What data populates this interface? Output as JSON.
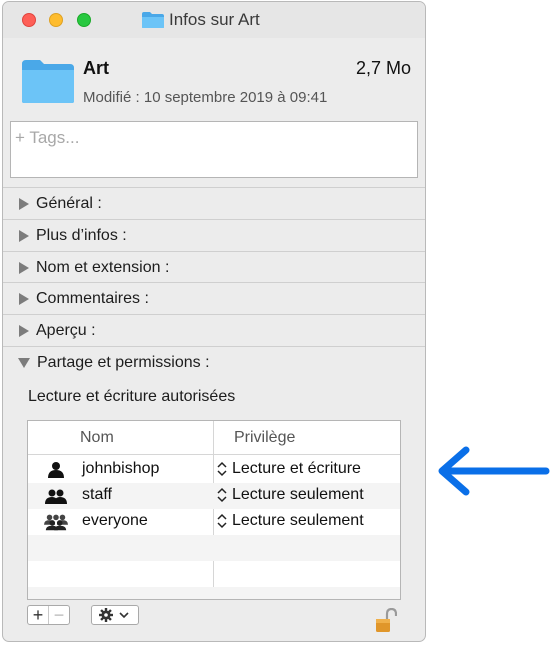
{
  "window": {
    "title": "Infos sur Art",
    "title_icon": "folder-icon"
  },
  "file": {
    "name": "Art",
    "size": "2,7 Mo",
    "modified": "Modifié : 10 septembre 2019 à 09:41",
    "icon": "folder-icon"
  },
  "tags": {
    "placeholder": "+ Tags...",
    "value": ""
  },
  "sections": [
    {
      "label": "Général :",
      "expanded": false
    },
    {
      "label": "Plus d’infos :",
      "expanded": false
    },
    {
      "label": "Nom et extension :",
      "expanded": false
    },
    {
      "label": "Commentaires :",
      "expanded": false
    },
    {
      "label": "Aperçu :",
      "expanded": false
    },
    {
      "label": "Partage et permissions :",
      "expanded": true
    }
  ],
  "permissions": {
    "status": "Lecture et écriture autorisées",
    "columns": {
      "name": "Nom",
      "privilege": "Privilège"
    },
    "rows": [
      {
        "name": "johnbishop",
        "privilege": "Lecture et écriture",
        "icon": "single-user-icon"
      },
      {
        "name": "staff",
        "privilege": "Lecture seulement",
        "icon": "group-icon"
      },
      {
        "name": "everyone",
        "privilege": "Lecture seulement",
        "icon": "everyone-icon"
      }
    ],
    "add_label": "+",
    "remove_label": "−"
  },
  "colors": {
    "accent_arrow": "#0a6fe8",
    "folder_blue": "#5ab8f2",
    "lock_orange": "#e0962a"
  }
}
